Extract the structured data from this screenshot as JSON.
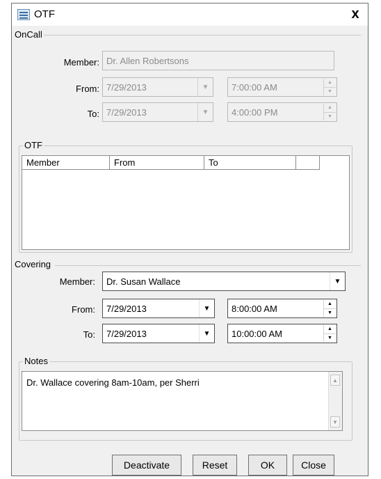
{
  "window": {
    "title": "OTF",
    "close_label": "x"
  },
  "oncall": {
    "group_label": "OnCall",
    "member_label": "Member:",
    "member_value": "Dr. Allen Robertsons",
    "from_label": "From:",
    "from_date": "7/29/2013",
    "from_time": "7:00:00 AM",
    "to_label": "To:",
    "to_date": "7/29/2013",
    "to_time": "4:00:00 PM"
  },
  "otf": {
    "group_label": "OTF",
    "columns": [
      "Member",
      "From",
      "To"
    ],
    "rows": []
  },
  "covering": {
    "group_label": "Covering",
    "member_label": "Member:",
    "member_value": "Dr. Susan Wallace",
    "from_label": "From:",
    "from_date": "7/29/2013",
    "from_time": "8:00:00 AM",
    "to_label": "To:",
    "to_date": "7/29/2013",
    "to_time": "10:00:00 AM"
  },
  "notes": {
    "group_label": "Notes",
    "text": "Dr. Wallace covering 8am-10am, per Sherri"
  },
  "buttons": {
    "deactivate": "Deactivate",
    "reset": "Reset",
    "ok": "OK",
    "close": "Close"
  }
}
